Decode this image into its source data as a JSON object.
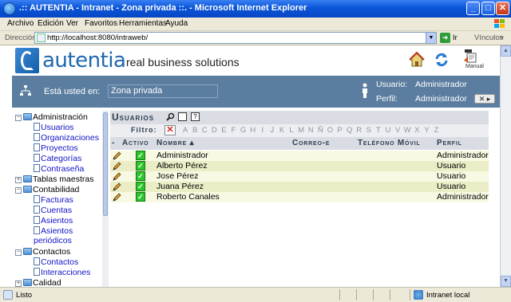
{
  "window": {
    "title": ".:: AUTENTIA - Intranet - Zona privada ::. - Microsoft Internet Explorer",
    "minimize": "_",
    "maximize": "□",
    "close": "✕"
  },
  "menu": [
    "Archivo",
    "Edición",
    "Ver",
    "Favoritos",
    "Herramientas",
    "Ayuda"
  ],
  "address": {
    "label": "Dirección",
    "url": "http://localhost:8080/intraweb/",
    "go_label": "Ir",
    "links_label": "Vínculos"
  },
  "header": {
    "logo_text": "autentia",
    "tagline": "real business solutions",
    "manual_label": "Manual"
  },
  "location": {
    "label": "Está usted en:",
    "value": "Zona privada",
    "user_key": "Usuario:",
    "user_value": "Administrador",
    "profile_key": "Perfil:",
    "profile_value": "Administrador",
    "logout_label": "✕ ▸"
  },
  "tree": {
    "nodes": [
      {
        "label": "Administración",
        "expanded": true
      },
      {
        "label": "Usuarios"
      },
      {
        "label": "Organizaciones"
      },
      {
        "label": "Proyectos"
      },
      {
        "label": "Categorías"
      },
      {
        "label": "Contraseña"
      },
      {
        "label": "Tablas maestras",
        "expanded": false
      },
      {
        "label": "Contabilidad",
        "expanded": true
      },
      {
        "label": "Facturas"
      },
      {
        "label": "Cuentas"
      },
      {
        "label": "Asientos"
      },
      {
        "label": "Asientos"
      },
      {
        "label": "periódicos"
      },
      {
        "label": "Contactos",
        "expanded": true
      },
      {
        "label": "Contactos"
      },
      {
        "label": "Interacciones"
      },
      {
        "label": "Calidad",
        "expanded": false
      }
    ]
  },
  "panel": {
    "title": "Usuarios",
    "filter_label": "Filtro:",
    "letters": [
      "A",
      "B",
      "C",
      "D",
      "E",
      "F",
      "G",
      "H",
      "I",
      "J",
      "K",
      "L",
      "M",
      "N",
      "Ñ",
      "O",
      "P",
      "Q",
      "R",
      "S",
      "T",
      "U",
      "V",
      "W",
      "X",
      "Y",
      "Z"
    ],
    "columns": {
      "sort_toggle": "-",
      "active": "Activo",
      "name": "Nombre ▴",
      "email": "Correo-e",
      "phone": "Teléfono Móvil",
      "profile": "Perfil"
    },
    "rows": [
      {
        "name": "Administrador",
        "profile": "Administrador"
      },
      {
        "name": "Alberto Pérez",
        "profile": "Usuario"
      },
      {
        "name": "Jose Pérez",
        "profile": "Usuario"
      },
      {
        "name": "Juana Pérez",
        "profile": "Usuario"
      },
      {
        "name": "Roberto Canales",
        "profile": "Administrador"
      }
    ]
  },
  "status": {
    "text": "Listo",
    "zone": "Intranet local"
  },
  "colors": {
    "location_bar": "#5b7ea0",
    "row_odd": "#f8f9e2",
    "row_even": "#eaedc6",
    "link": "#1212c8",
    "brand": "#1f67b0"
  }
}
